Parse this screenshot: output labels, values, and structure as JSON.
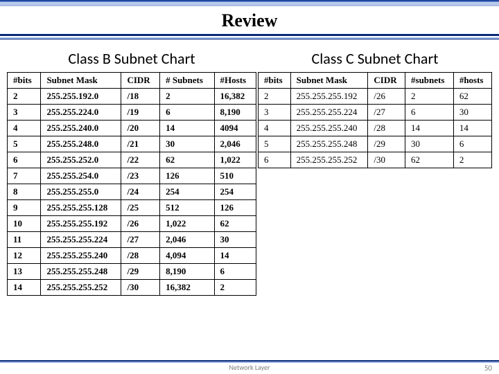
{
  "title": "Review",
  "subtitles": {
    "left": "Class B Subnet Chart",
    "right": "Class C Subnet Chart"
  },
  "chart_data": [
    {
      "type": "table",
      "title": "Class B Subnet Chart",
      "columns": [
        "#bits",
        "Subnet Mask",
        "CIDR",
        "# Subnets",
        "#Hosts"
      ],
      "rows": [
        [
          "2",
          "255.255.192.0",
          "/18",
          "2",
          "16,382"
        ],
        [
          "3",
          "255.255.224.0",
          "/19",
          "6",
          "8,190"
        ],
        [
          "4",
          "255.255.240.0",
          "/20",
          "14",
          "4094"
        ],
        [
          "5",
          "255.255.248.0",
          "/21",
          "30",
          "2,046"
        ],
        [
          "6",
          "255.255.252.0",
          "/22",
          "62",
          "1,022"
        ],
        [
          "7",
          "255.255.254.0",
          "/23",
          "126",
          "510"
        ],
        [
          "8",
          "255.255.255.0",
          "/24",
          "254",
          "254"
        ],
        [
          "9",
          "255.255.255.128",
          "/25",
          "512",
          "126"
        ],
        [
          "10",
          "255.255.255.192",
          "/26",
          "1,022",
          "62"
        ],
        [
          "11",
          "255.255.255.224",
          "/27",
          "2,046",
          "30"
        ],
        [
          "12",
          "255.255.255.240",
          "/28",
          "4,094",
          "14"
        ],
        [
          "13",
          "255.255.255.248",
          "/29",
          "8,190",
          "6"
        ],
        [
          "14",
          "255.255.255.252",
          "/30",
          "16,382",
          "2"
        ]
      ]
    },
    {
      "type": "table",
      "title": "Class C Subnet Chart",
      "columns": [
        "#bits",
        "Subnet Mask",
        "CIDR",
        "#subnets",
        "#hosts"
      ],
      "rows": [
        [
          "2",
          "255.255.255.192",
          "/26",
          "2",
          "62"
        ],
        [
          "3",
          "255.255.255.224",
          "/27",
          "6",
          "30"
        ],
        [
          "4",
          "255.255.255.240",
          "/28",
          "14",
          "14"
        ],
        [
          "5",
          "255.255.255.248",
          "/29",
          "30",
          "6"
        ],
        [
          "6",
          "255.255.255.252",
          "/30",
          "62",
          "2"
        ]
      ]
    }
  ],
  "footer": {
    "label": "Network Layer",
    "page": "50"
  }
}
